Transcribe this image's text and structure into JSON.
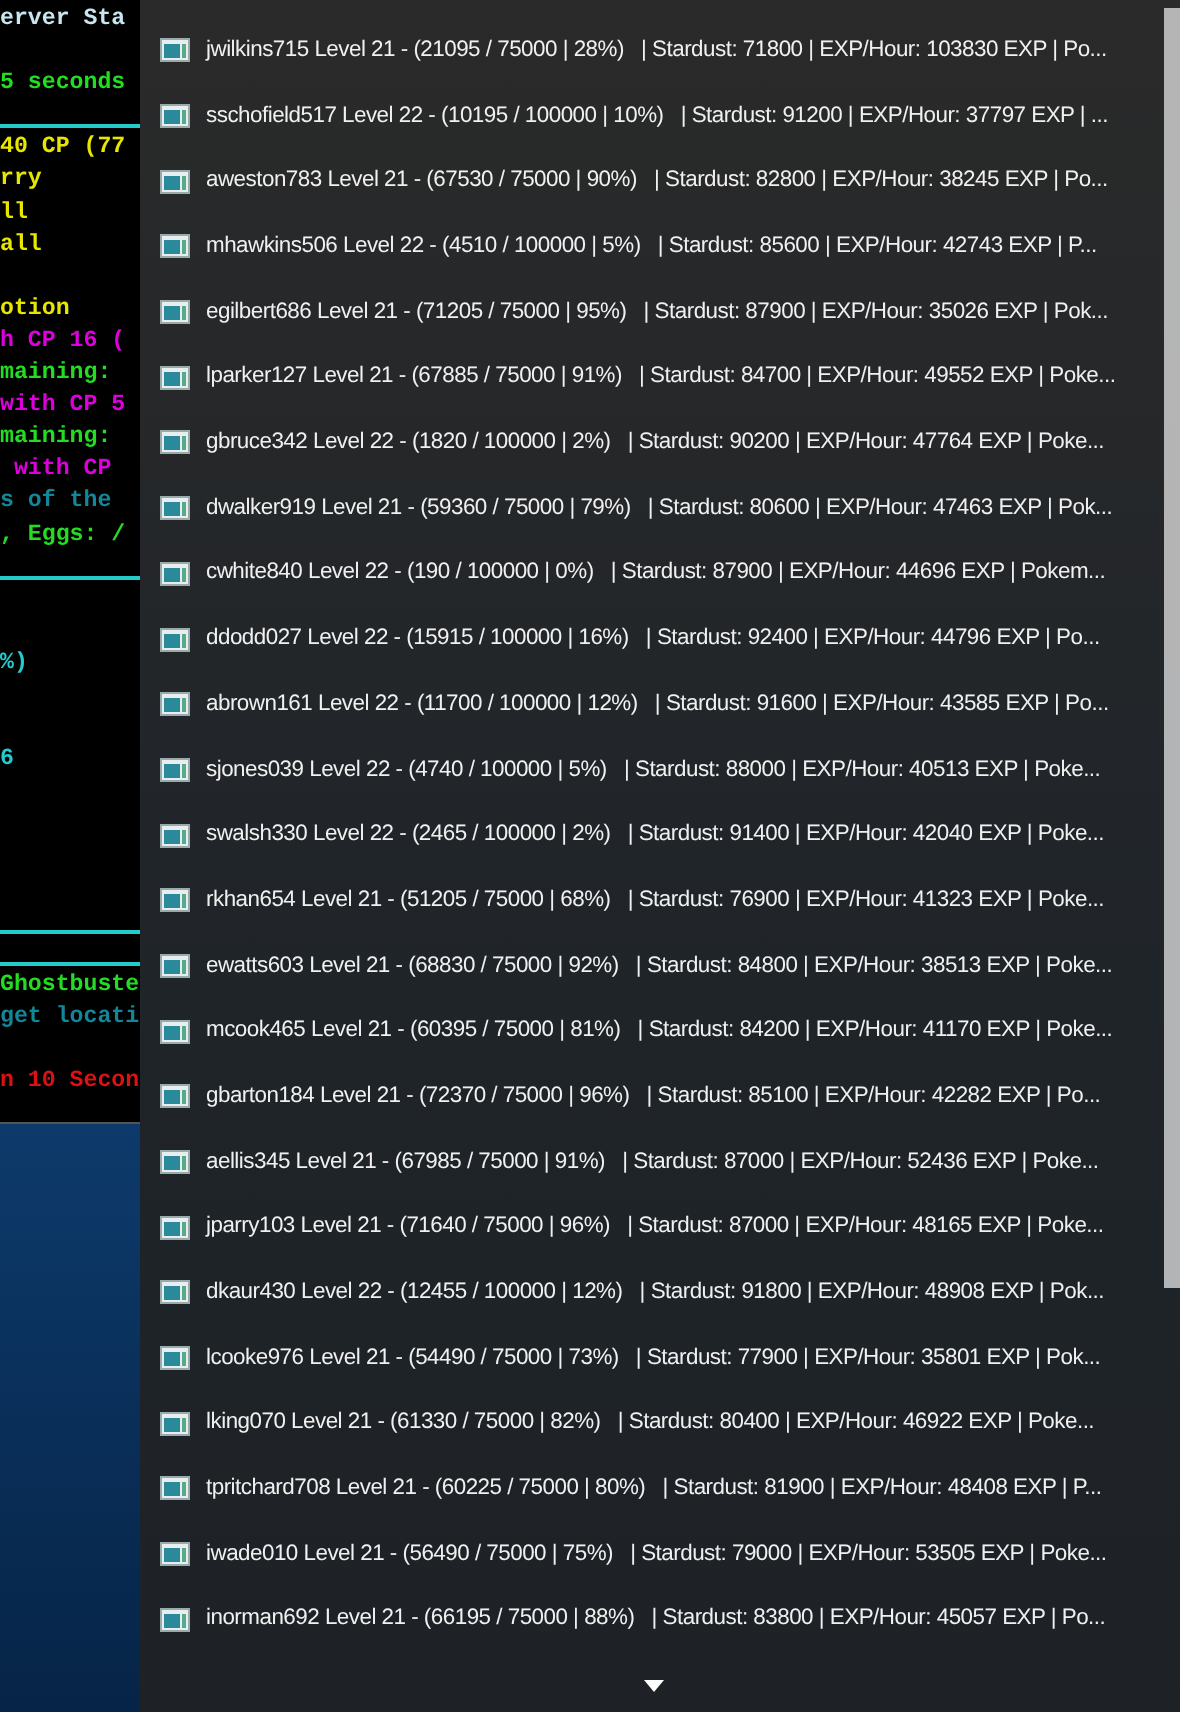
{
  "console": {
    "lines": [
      {
        "kind": "text",
        "text": "erver Sta",
        "color": "#c8e6f0"
      },
      {
        "kind": "blank"
      },
      {
        "kind": "text",
        "text": "5 seconds",
        "color": "#22dd22"
      },
      {
        "kind": "rule",
        "color": "#22cccc"
      },
      {
        "kind": "text",
        "text": "40 CP (77",
        "color": "#e6e600"
      },
      {
        "kind": "text",
        "text": "rry",
        "color": "#e6e600"
      },
      {
        "kind": "text",
        "text": "ll",
        "color": "#e6e600"
      },
      {
        "kind": "text",
        "text": "all",
        "color": "#e6e600"
      },
      {
        "kind": "blank"
      },
      {
        "kind": "text",
        "text": "otion",
        "color": "#e6e600"
      },
      {
        "kind": "text",
        "text": "h CP 16 (",
        "color": "#dd00dd"
      },
      {
        "kind": "text",
        "text": "maining:",
        "color": "#22dd22"
      },
      {
        "kind": "text",
        "text": "with CP 5",
        "color": "#dd00dd"
      },
      {
        "kind": "text",
        "text": "maining:",
        "color": "#22dd22"
      },
      {
        "kind": "text",
        "text": " with CP",
        "color": "#dd00dd"
      },
      {
        "kind": "text",
        "text": "s of the",
        "color": "#118899"
      },
      {
        "kind": "text",
        "text": ", Eggs: /",
        "color": "#22dd22"
      },
      {
        "kind": "rule",
        "color": "#22cccc"
      },
      {
        "kind": "blank"
      },
      {
        "kind": "blank"
      },
      {
        "kind": "text",
        "text": "%)",
        "color": "#22cccc"
      },
      {
        "kind": "blank"
      },
      {
        "kind": "blank"
      },
      {
        "kind": "text",
        "text": "6",
        "color": "#22cccc"
      },
      {
        "kind": "blank"
      },
      {
        "kind": "blank"
      },
      {
        "kind": "blank"
      },
      {
        "kind": "blank"
      },
      {
        "kind": "rule",
        "color": "#22cccc"
      },
      {
        "kind": "rule",
        "color": "#22cccc"
      },
      {
        "kind": "text",
        "text": "Ghostbuste",
        "color": "#22dd22"
      },
      {
        "kind": "text",
        "text": "get locati",
        "color": "#118899"
      },
      {
        "kind": "blank"
      },
      {
        "kind": "text",
        "text": "n 10 Secon",
        "color": "#dd1111"
      }
    ]
  },
  "jump_list": {
    "items": [
      {
        "label": "jwilkins715 Level 21 - (21095 / 75000 | 28%)   | Stardust: 71800 | EXP/Hour: 103830 EXP | Po..."
      },
      {
        "label": "sschofield517 Level 22 - (10195 / 100000 | 10%)   | Stardust: 91200 | EXP/Hour: 37797 EXP | ..."
      },
      {
        "label": "aweston783 Level 21 - (67530 / 75000 | 90%)   | Stardust: 82800 | EXP/Hour: 38245 EXP | Po..."
      },
      {
        "label": "mhawkins506 Level 22 - (4510 / 100000 | 5%)   | Stardust: 85600 | EXP/Hour: 42743 EXP | P..."
      },
      {
        "label": "egilbert686 Level 21 - (71205 / 75000 | 95%)   | Stardust: 87900 | EXP/Hour: 35026 EXP | Pok..."
      },
      {
        "label": "lparker127 Level 21 - (67885 / 75000 | 91%)   | Stardust: 84700 | EXP/Hour: 49552 EXP | Poke..."
      },
      {
        "label": "gbruce342 Level 22 - (1820 / 100000 | 2%)   | Stardust: 90200 | EXP/Hour: 47764 EXP | Poke..."
      },
      {
        "label": "dwalker919 Level 21 - (59360 / 75000 | 79%)   | Stardust: 80600 | EXP/Hour: 47463 EXP | Pok..."
      },
      {
        "label": "cwhite840 Level 22 - (190 / 100000 | 0%)   | Stardust: 87900 | EXP/Hour: 44696 EXP | Pokem..."
      },
      {
        "label": "ddodd027 Level 22 - (15915 / 100000 | 16%)   | Stardust: 92400 | EXP/Hour: 44796 EXP | Po..."
      },
      {
        "label": "abrown161 Level 22 - (11700 / 100000 | 12%)   | Stardust: 91600 | EXP/Hour: 43585 EXP | Po..."
      },
      {
        "label": "sjones039 Level 22 - (4740 / 100000 | 5%)   | Stardust: 88000 | EXP/Hour: 40513 EXP | Poke..."
      },
      {
        "label": "swalsh330 Level 22 - (2465 / 100000 | 2%)   | Stardust: 91400 | EXP/Hour: 42040 EXP | Poke..."
      },
      {
        "label": "rkhan654 Level 21 - (51205 / 75000 | 68%)   | Stardust: 76900 | EXP/Hour: 41323 EXP | Poke..."
      },
      {
        "label": "ewatts603 Level 21 - (68830 / 75000 | 92%)   | Stardust: 84800 | EXP/Hour: 38513 EXP | Poke..."
      },
      {
        "label": "mcook465 Level 21 - (60395 / 75000 | 81%)   | Stardust: 84200 | EXP/Hour: 41170 EXP | Poke..."
      },
      {
        "label": "gbarton184 Level 21 - (72370 / 75000 | 96%)   | Stardust: 85100 | EXP/Hour: 42282 EXP | Po..."
      },
      {
        "label": "aellis345 Level 21 - (67985 / 75000 | 91%)   | Stardust: 87000 | EXP/Hour: 52436 EXP | Poke..."
      },
      {
        "label": "jparry103 Level 21 - (71640 / 75000 | 96%)   | Stardust: 87000 | EXP/Hour: 48165 EXP | Poke..."
      },
      {
        "label": "dkaur430 Level 22 - (12455 / 100000 | 12%)   | Stardust: 91800 | EXP/Hour: 48908 EXP | Pok..."
      },
      {
        "label": "lcooke976 Level 21 - (54490 / 75000 | 73%)   | Stardust: 77900 | EXP/Hour: 35801 EXP | Pok..."
      },
      {
        "label": "lking070 Level 21 - (61330 / 75000 | 82%)   | Stardust: 80400 | EXP/Hour: 46922 EXP | Poke..."
      },
      {
        "label": "tpritchard708 Level 21 - (60225 / 75000 | 80%)   | Stardust: 81900 | EXP/Hour: 48408 EXP | P..."
      },
      {
        "label": "iwade010 Level 21 - (56490 / 75000 | 75%)   | Stardust: 79000 | EXP/Hour: 53505 EXP | Poke..."
      },
      {
        "label": "inorman692 Level 21 - (66195 / 75000 | 88%)   | Stardust: 83800 | EXP/Hour: 45057 EXP | Po..."
      }
    ]
  }
}
